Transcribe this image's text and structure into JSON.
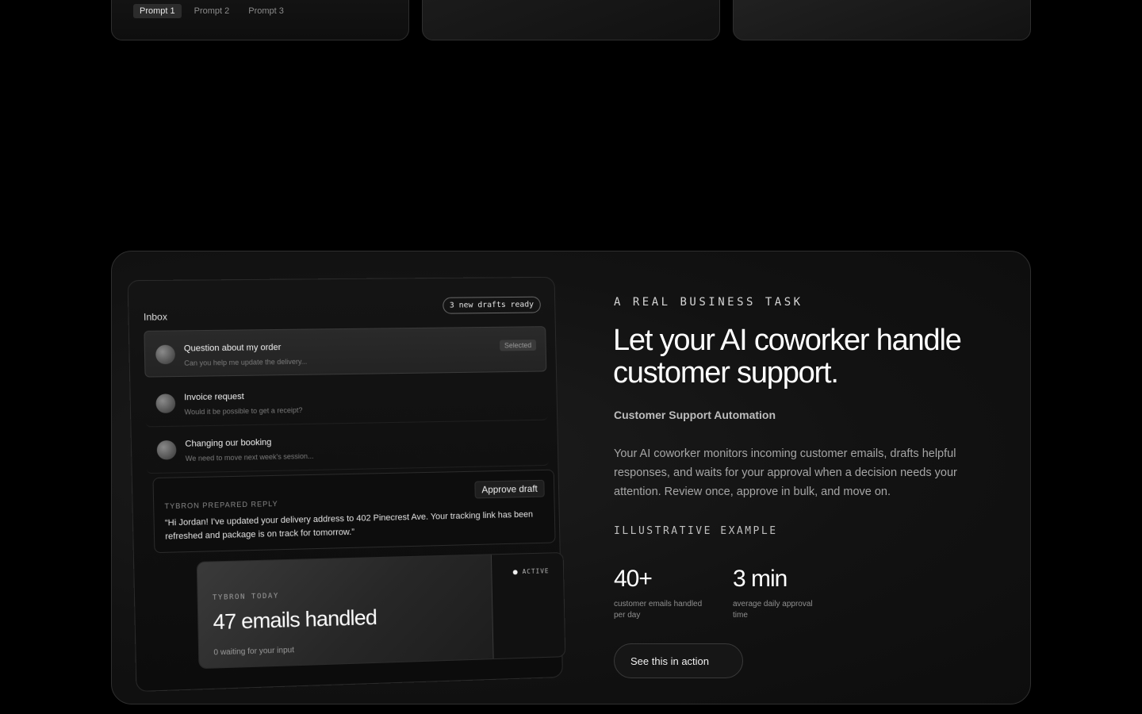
{
  "top_cards": {
    "prompt_tabs": [
      {
        "label": "Prompt 1",
        "active": true
      },
      {
        "label": "Prompt 2",
        "active": false
      },
      {
        "label": "Prompt 3",
        "active": false
      }
    ]
  },
  "mock": {
    "inbox_title": "Inbox",
    "drafts_pill": "3 new drafts ready",
    "emails": [
      {
        "subject": "Question about my order",
        "preview": "Can you help me update the delivery...",
        "badge": "Selected"
      },
      {
        "subject": "Invoice request",
        "preview": "Would it be possible to get a receipt?"
      },
      {
        "subject": "Changing our booking",
        "preview": "We need to move next week's session..."
      }
    ],
    "reply": {
      "label": "TYBRON PREPARED REPLY",
      "approve_label": "Approve draft",
      "text": "“Hi Jordan! I've updated your delivery address to 402 Pinecrest Ave. Your tracking link has been refreshed and package is on track for tomorrow.”"
    },
    "stats": {
      "label": "TYBRON  TODAY",
      "value": "47 emails handled",
      "sub": "0 waiting for your input",
      "status": "ACTIVE"
    }
  },
  "content": {
    "eyebrow": "A REAL BUSINESS TASK",
    "headline": "Let your AI coworker handle customer support.",
    "subhead": "Customer Support Automation",
    "body": "Your AI coworker monitors incoming customer emails, drafts helpful responses, and waits for your approval when a decision needs your attention. Review once, approve in bulk, and move on.",
    "illustrative": "ILLUSTRATIVE EXAMPLE",
    "metrics": [
      {
        "value": "40+",
        "label": "customer emails handled per day"
      },
      {
        "value": "3 min",
        "label": "average daily approval time"
      }
    ],
    "cta_label": "See this in action"
  }
}
